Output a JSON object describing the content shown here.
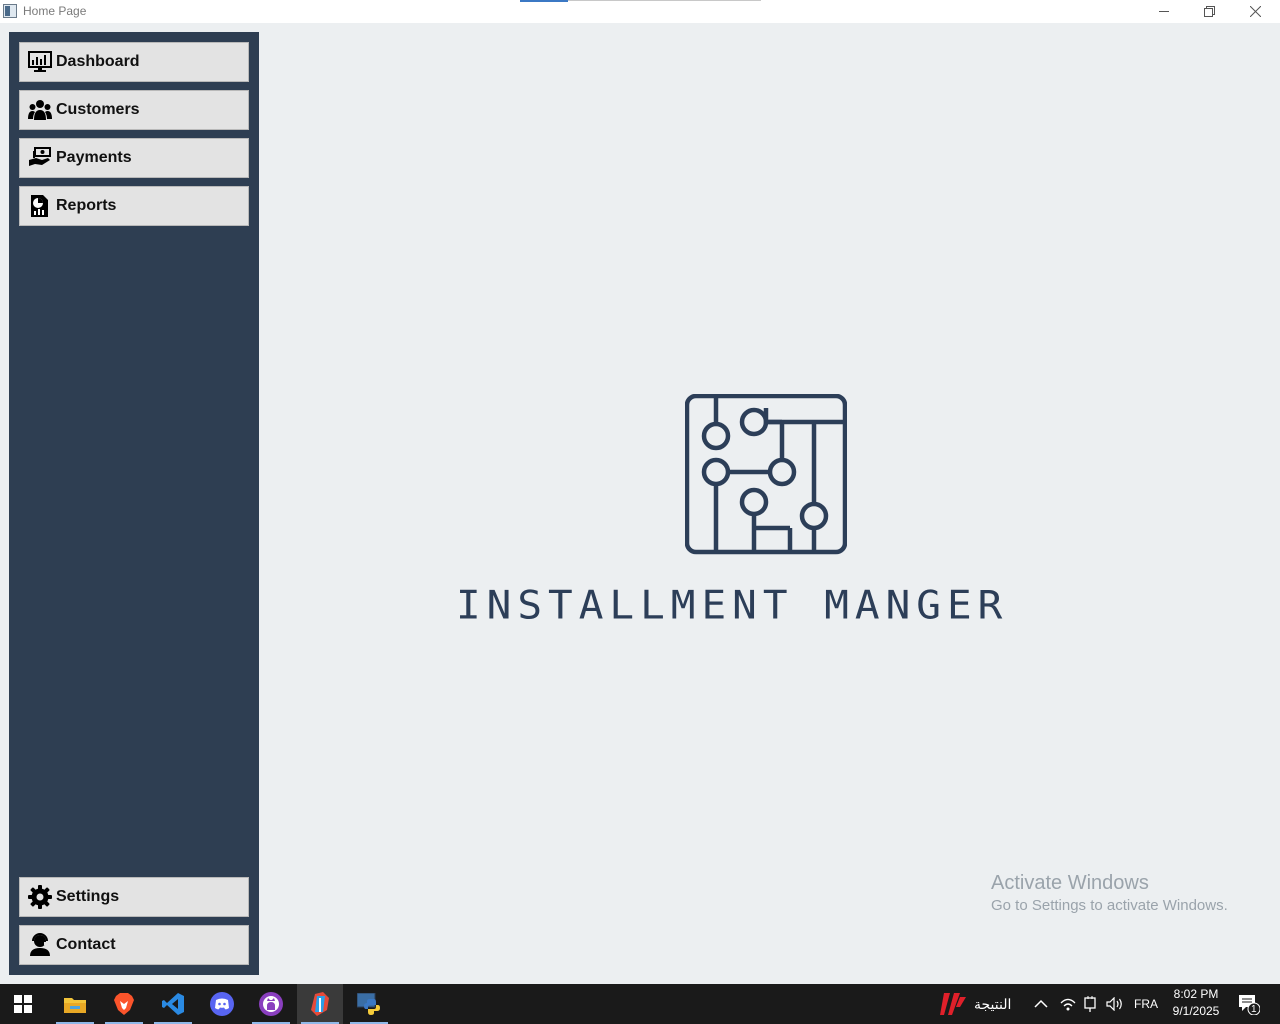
{
  "window": {
    "title": "Home Page",
    "controls": {
      "minimize_icon": "minimize-icon",
      "maximize_icon": "restore-icon",
      "close_icon": "close-icon"
    }
  },
  "sidebar": {
    "background": "#2e3e52",
    "items": [
      {
        "label": "Dashboard",
        "icon": "dashboard-monitor-icon"
      },
      {
        "label": "Customers",
        "icon": "customers-group-icon"
      },
      {
        "label": "Payments",
        "icon": "payments-hand-money-icon"
      },
      {
        "label": "Reports",
        "icon": "reports-chart-icon"
      }
    ],
    "bottom_items": [
      {
        "label": "Settings",
        "icon": "gear-icon"
      },
      {
        "label": "Contact",
        "icon": "contact-headset-icon"
      }
    ]
  },
  "main": {
    "logo_text": "INSTALLMENT MANGER",
    "logo_color": "#2c3e58",
    "background": "#eceff1"
  },
  "watermark": {
    "line1": "Activate Windows",
    "line2": "Go to Settings to activate Windows."
  },
  "taskbar": {
    "apps": [
      "windows-start-icon",
      "file-explorer-icon",
      "brave-browser-icon",
      "vscode-icon",
      "discord-icon",
      "github-desktop-icon",
      "pycharm-icon",
      "python-icon"
    ],
    "news_label": "النتيجة",
    "language": "FRA",
    "time": "8:02 PM",
    "date": "9/1/2025",
    "notification_count": "1"
  }
}
